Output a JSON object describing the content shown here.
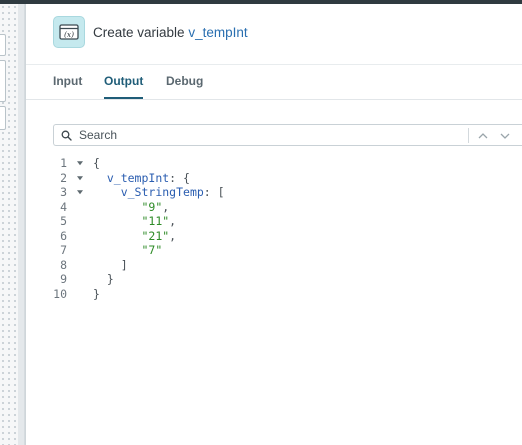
{
  "header": {
    "title_prefix": "Create variable",
    "title_variable": "v_tempInt",
    "icon": "variable-x-icon"
  },
  "tabs": [
    {
      "label": "Input",
      "active": false
    },
    {
      "label": "Output",
      "active": true
    },
    {
      "label": "Debug",
      "active": false
    }
  ],
  "search": {
    "placeholder": "Search",
    "value": "",
    "icons": [
      "search-icon",
      "chevron-up-icon",
      "chevron-down-icon"
    ]
  },
  "code": {
    "lines": [
      {
        "num": "1",
        "foldable": true,
        "indent": "",
        "key": "",
        "value": "",
        "punct": "{"
      },
      {
        "num": "2",
        "foldable": true,
        "indent": "  ",
        "key": "v_tempInt",
        "value": "",
        "punct": ": {"
      },
      {
        "num": "3",
        "foldable": true,
        "indent": "    ",
        "key": "v_StringTemp",
        "value": "",
        "punct": ": ["
      },
      {
        "num": "4",
        "foldable": false,
        "indent": "       ",
        "key": "",
        "value": "\"9\"",
        "punct": ","
      },
      {
        "num": "5",
        "foldable": false,
        "indent": "       ",
        "key": "",
        "value": "\"11\"",
        "punct": ","
      },
      {
        "num": "6",
        "foldable": false,
        "indent": "       ",
        "key": "",
        "value": "\"21\"",
        "punct": ","
      },
      {
        "num": "7",
        "foldable": false,
        "indent": "       ",
        "key": "",
        "value": "\"7\"",
        "punct": ""
      },
      {
        "num": "8",
        "foldable": false,
        "indent": "    ",
        "key": "",
        "value": "",
        "punct": "]"
      },
      {
        "num": "9",
        "foldable": false,
        "indent": "  ",
        "key": "",
        "value": "",
        "punct": "}"
      },
      {
        "num": "10",
        "foldable": false,
        "indent": "",
        "key": "",
        "value": "",
        "punct": "}"
      }
    ]
  },
  "colors": {
    "active_tab": "#1f5d78",
    "json_key": "#2a5db0",
    "json_string": "#2e8b27",
    "icon_background": "#c5e9ee"
  }
}
